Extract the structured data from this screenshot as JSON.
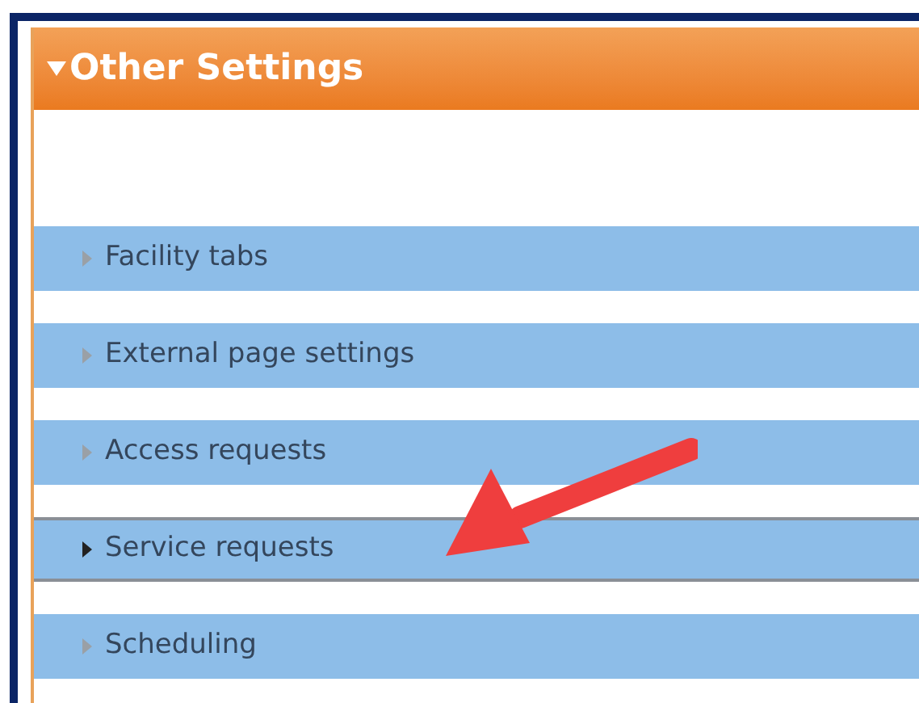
{
  "section": {
    "title": "Other Settings",
    "expanded": true
  },
  "items": [
    {
      "label": "Facility tabs",
      "selected": false
    },
    {
      "label": "External page settings",
      "selected": false
    },
    {
      "label": "Access requests",
      "selected": false
    },
    {
      "label": "Service requests",
      "selected": true
    },
    {
      "label": "Scheduling",
      "selected": false
    }
  ]
}
